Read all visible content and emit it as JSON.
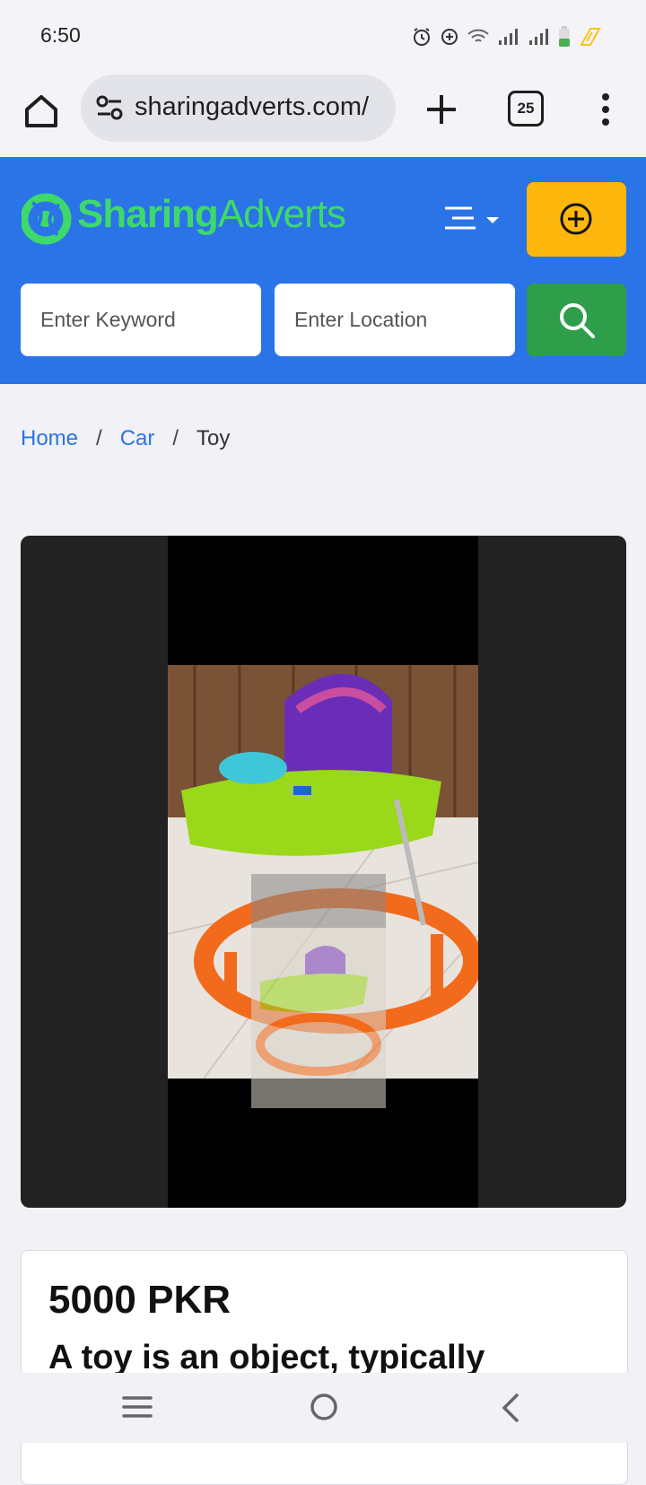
{
  "status": {
    "time": "6:50"
  },
  "browser": {
    "url": "sharingadverts.com/",
    "tab_count": "25"
  },
  "site": {
    "logo_part1": "Sharing",
    "logo_part2": "Adverts",
    "brand_color": "#2a74e8",
    "add_color": "#fdb70d",
    "search_color": "#2e9e4a"
  },
  "search": {
    "keyword_placeholder": "Enter Keyword",
    "location_placeholder": "Enter Location"
  },
  "breadcrumb": {
    "home": "Home",
    "sep": "/",
    "category": "Car",
    "current": "Toy"
  },
  "listing": {
    "price": "5000 PKR",
    "title_preview": "A toy is an object, typically"
  }
}
